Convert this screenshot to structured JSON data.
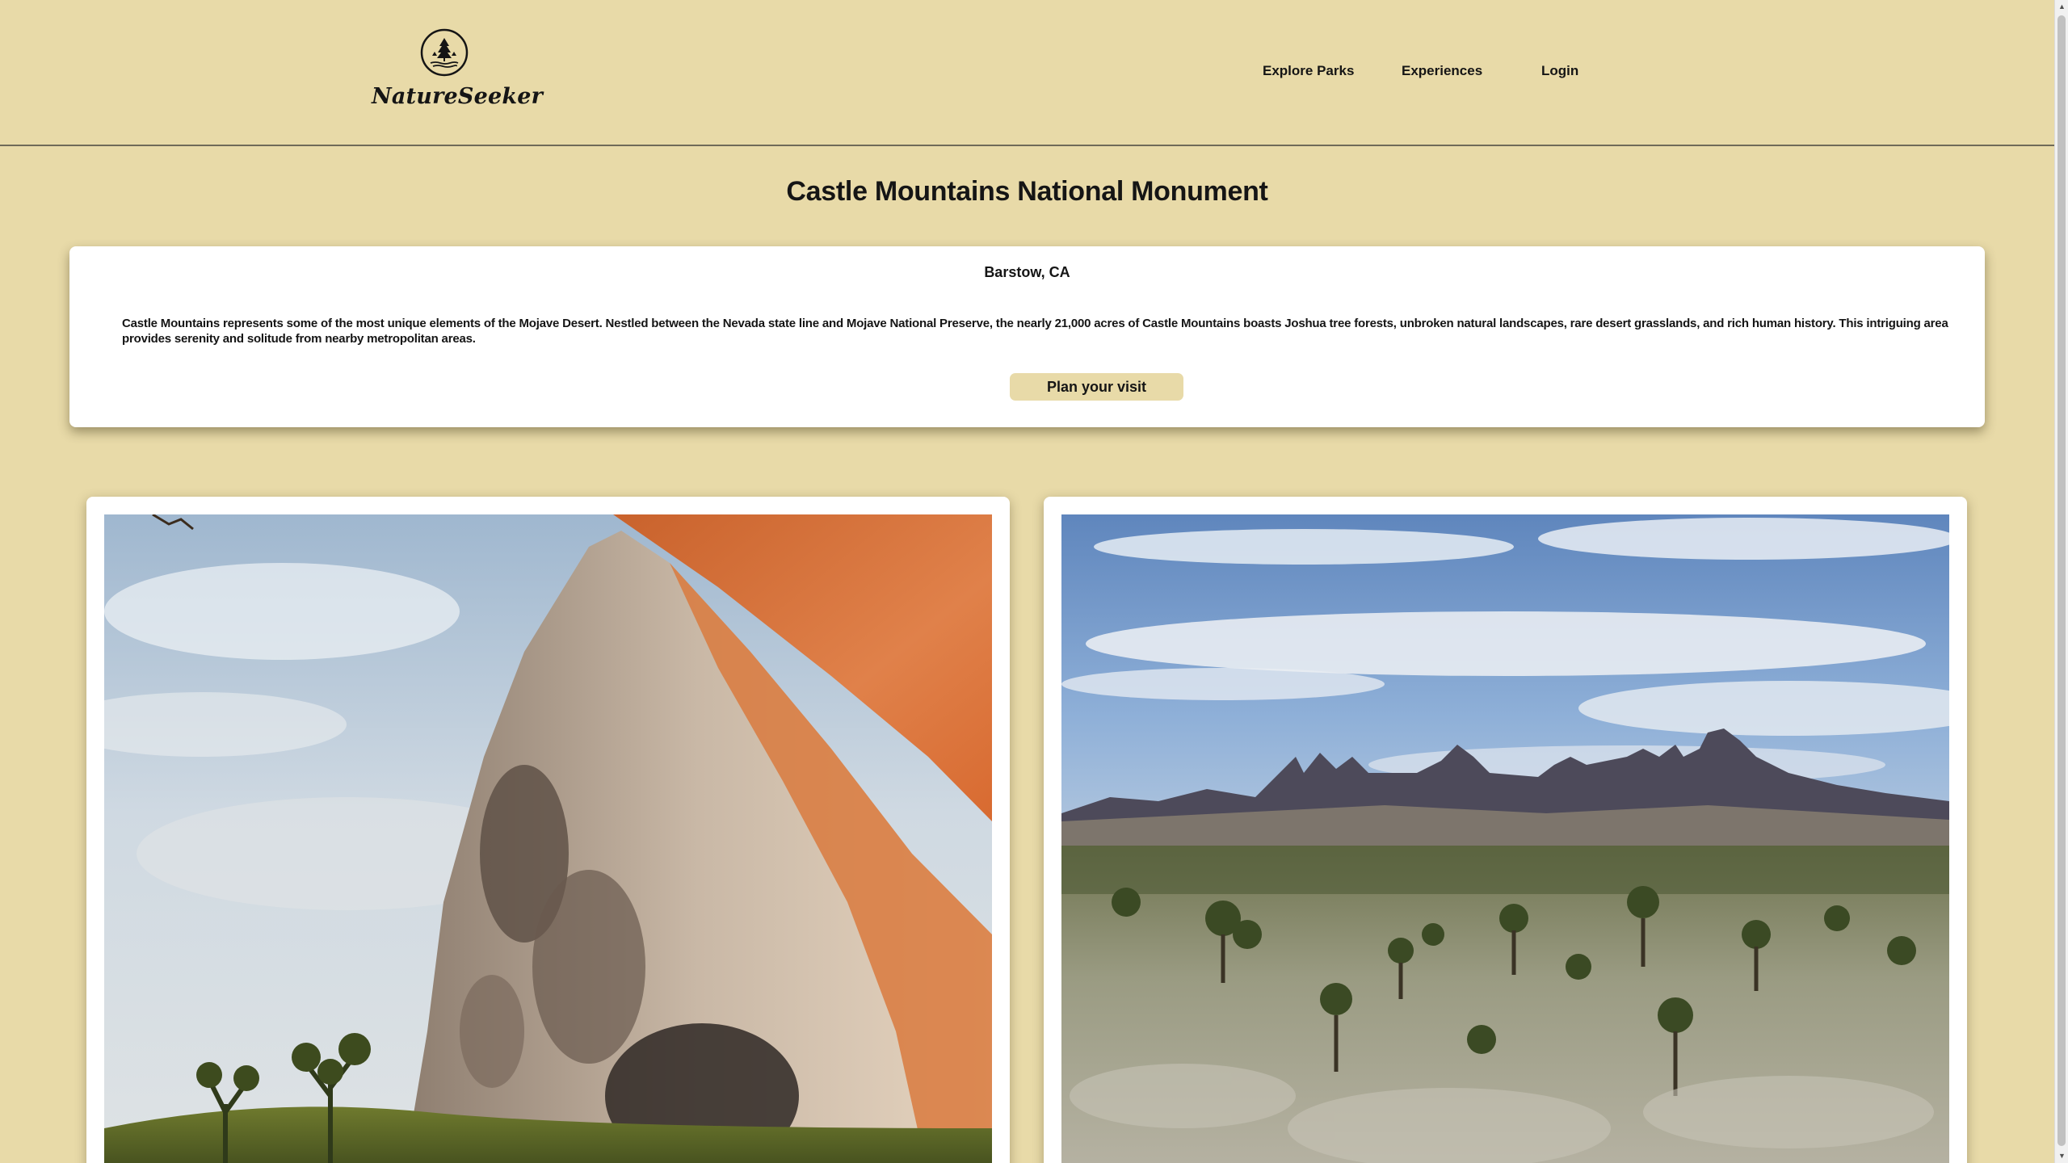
{
  "brand": {
    "name": "NatureSeeker",
    "icon": "tree-lake-logo-icon"
  },
  "nav": {
    "explore": "Explore Parks",
    "experiences": "Experiences",
    "login": "Login"
  },
  "park": {
    "title": "Castle Mountains National Monument",
    "location": "Barstow, CA",
    "description": "Castle Mountains represents some of the most unique elements of the Mojave Desert. Nestled between the Nevada state line and Mojave National Preserve, the nearly 21,000 acres of Castle Mountains boasts Joshua tree forests, unbroken natural landscapes, rare desert grasslands, and rich human history. This intriguing area provides serenity and solitude from nearby metropolitan areas.",
    "cta": "Plan your visit"
  },
  "photos": [
    {
      "subject": "granite-rock-formation-photo"
    },
    {
      "subject": "castle-peaks-landscape-photo"
    }
  ],
  "colors": {
    "background": "#e8daa8",
    "card": "#ffffff",
    "text": "#151515",
    "button": "#e8daa8"
  }
}
